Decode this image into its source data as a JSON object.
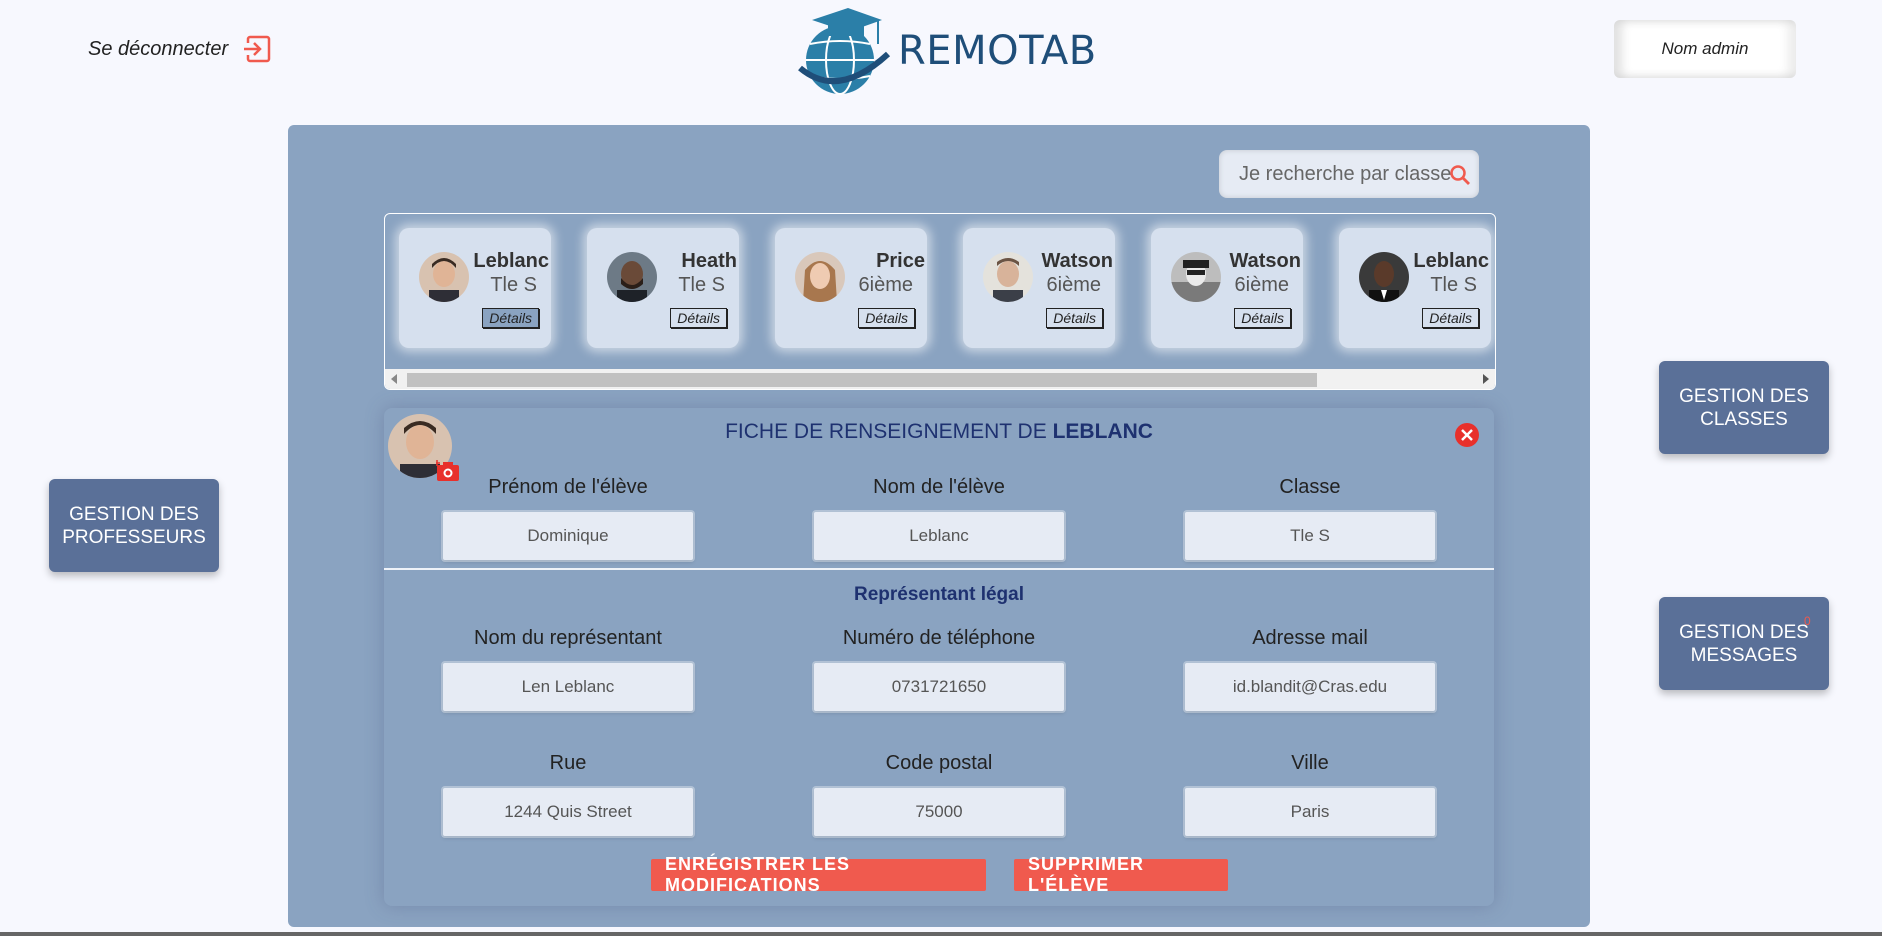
{
  "header": {
    "logout_label": "Se déconnecter",
    "logo_text": "REMOTAB",
    "admin_label": "Nom admin"
  },
  "side_nav": {
    "professeurs": "GESTION DES PROFESSEURS",
    "classes": "GESTION DES CLASSES",
    "messages": "GESTION DES MESSAGES",
    "messages_count": "0"
  },
  "search": {
    "placeholder": "Je recherche par classe"
  },
  "students": [
    {
      "name": "Leblanc",
      "class": "Tle S",
      "details": "Détails"
    },
    {
      "name": "Heath",
      "class": "Tle S",
      "details": "Détails"
    },
    {
      "name": "Price",
      "class": "6ième",
      "details": "Détails"
    },
    {
      "name": "Watson",
      "class": "6ième",
      "details": "Détails"
    },
    {
      "name": "Watson",
      "class": "6ième",
      "details": "Détails"
    },
    {
      "name": "Leblanc",
      "class": "Tle S",
      "details": "Détails"
    }
  ],
  "fiche": {
    "title_prefix": "FICHE DE RENSEIGNEMENT DE ",
    "title_name": "LEBLANC",
    "fields": {
      "prenom": {
        "label": "Prénom de l'élève",
        "value": "Dominique"
      },
      "nom": {
        "label": "Nom de l'élève",
        "value": "Leblanc"
      },
      "classe": {
        "label": "Classe",
        "value": "Tle S"
      },
      "nom_rep": {
        "label": "Nom du représentant",
        "value": "Len Leblanc"
      },
      "tel": {
        "label": "Numéro de téléphone",
        "value": "0731721650"
      },
      "mail": {
        "label": "Adresse mail",
        "value": "id.blandit@Cras.edu"
      },
      "rue": {
        "label": "Rue",
        "value": "1244 Quis Street"
      },
      "cp": {
        "label": "Code postal",
        "value": "75000"
      },
      "ville": {
        "label": "Ville",
        "value": "Paris"
      }
    },
    "section_title": "Représentant légal",
    "save_label": "ENRÉGISTRER LES MODIFICATIONS",
    "delete_label": "SUPPRIMER L'ÉLÈVE"
  },
  "colors": {
    "panel": "#8aa3c1",
    "side_button": "#5a7098",
    "accent": "#f05a4e",
    "title": "#1e3170"
  }
}
